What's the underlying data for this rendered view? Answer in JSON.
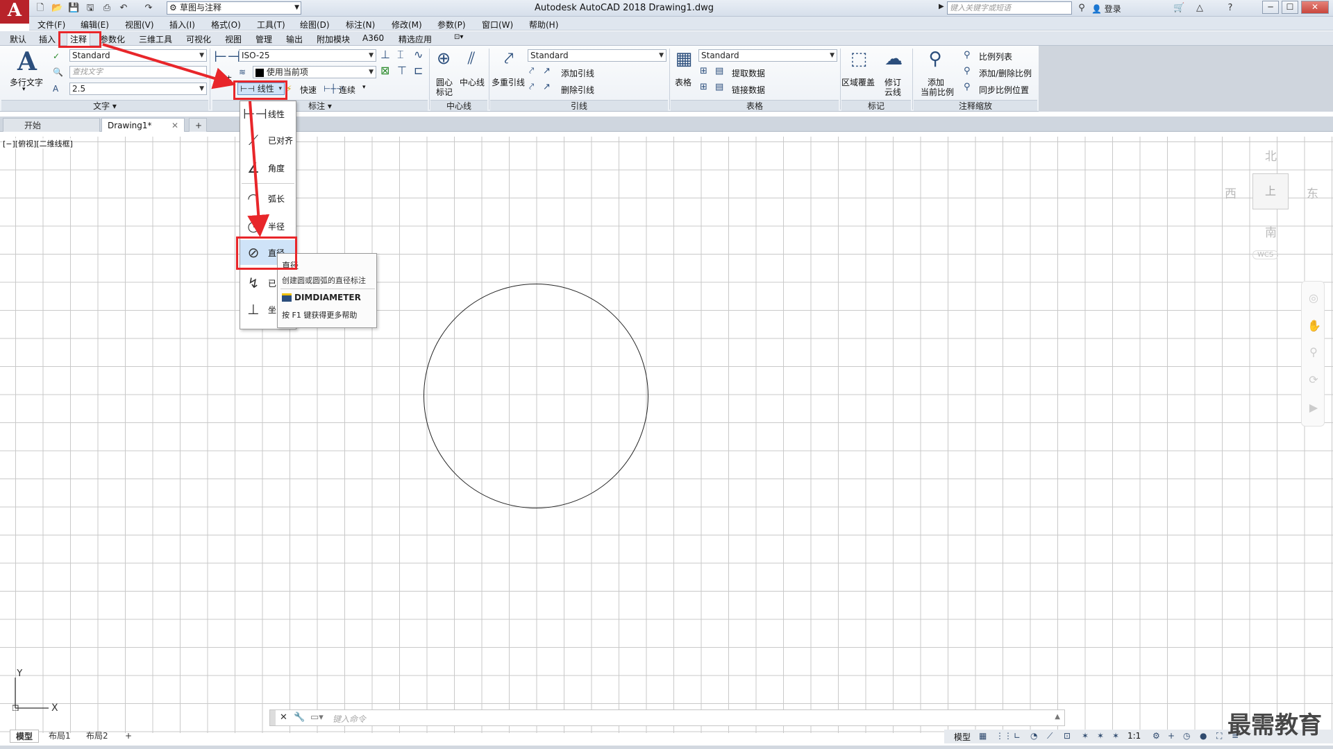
{
  "titlebar": {
    "app_title": "Autodesk AutoCAD 2018    Drawing1.dwg",
    "workspace": "草图与注释",
    "search_placeholder": "键入关键字或短语",
    "login": "登录",
    "help": "?"
  },
  "menu": [
    "文件(F)",
    "编辑(E)",
    "视图(V)",
    "插入(I)",
    "格式(O)",
    "工具(T)",
    "绘图(D)",
    "标注(N)",
    "修改(M)",
    "参数(P)",
    "窗口(W)",
    "帮助(H)"
  ],
  "ribbon_tabs": [
    "默认",
    "插入",
    "注释",
    "参数化",
    "三维工具",
    "可视化",
    "视图",
    "管理",
    "输出",
    "附加模块",
    "A360",
    "精选应用"
  ],
  "ribbon": {
    "text_panel": {
      "title": "文字",
      "mtext_label": "多行文字",
      "style": "Standard",
      "find_placeholder": "查找文字",
      "height": "2.5"
    },
    "dim_panel": {
      "title": "标注",
      "dim_label": "标注",
      "style": "ISO-25",
      "layer": "使用当前项",
      "linear_split": "线性",
      "quick": "快速",
      "continue": "连续"
    },
    "centerline_panel": {
      "title": "中心线",
      "center_mark": "圆心\n标记",
      "center_mark_1": "圆心",
      "center_mark_2": "标记",
      "centerline": "中心线"
    },
    "leader_panel": {
      "title": "引线",
      "multileader": "多重引线",
      "style": "Standard",
      "add": "添加引线",
      "remove": "删除引线"
    },
    "table_panel": {
      "title": "表格",
      "table": "表格",
      "style": "Standard",
      "extract": "提取数据",
      "link": "链接数据"
    },
    "markup_panel": {
      "title": "标记",
      "wipeout": "区域覆盖",
      "revcloud_1": "修订",
      "revcloud_2": "云线"
    },
    "scale_panel": {
      "title": "注释缩放",
      "add_current_1": "添加",
      "add_current_2": "当前比例",
      "scale_list": "比例列表",
      "add_delete": "添加/删除比例",
      "sync": "同步比例位置"
    }
  },
  "doc_tabs": [
    "开始",
    "Drawing1*"
  ],
  "viewport_label": "[−][俯视][二维线框]",
  "dropdown_items": [
    "线性",
    "已对齐",
    "角度",
    "弧长",
    "半径",
    "直径",
    "已折弯",
    "坐标"
  ],
  "dropdown_visible": [
    "线性",
    "已对齐",
    "角度",
    "弧长",
    "半径",
    "直径",
    "已",
    "坐"
  ],
  "tooltip": {
    "title": "直径",
    "description": "创建圆或圆弧的直径标注",
    "command": "DIMDIAMETER",
    "help": "按 F1 键获得更多帮助"
  },
  "viewcube": {
    "north": "北",
    "south": "南",
    "east": "东",
    "west": "西",
    "face": "上",
    "wcs": "WCS"
  },
  "ucs": {
    "x": "X",
    "y": "Y"
  },
  "command_placeholder": "键入命令",
  "layout_tabs": [
    "模型",
    "布局1",
    "布局2"
  ],
  "status": {
    "model": "模型",
    "scale": "1:1"
  },
  "watermark": "最需教育",
  "colors": {
    "accent": "#e8262a",
    "logo": "#b8232a"
  }
}
